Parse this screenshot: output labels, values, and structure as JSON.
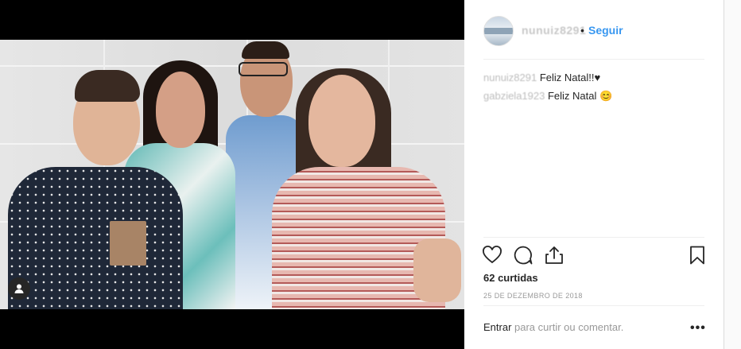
{
  "header": {
    "username": "nunuiz8291",
    "separator": "•",
    "follow_label": "Seguir"
  },
  "comments": [
    {
      "user": "nunuiz8291",
      "text": "Feliz Natal!!♥"
    },
    {
      "user": "gabziela1923",
      "text": "Feliz Natal 😊"
    }
  ],
  "actions": {
    "like_icon": "heart-icon",
    "comment_icon": "comment-icon",
    "share_icon": "share-icon",
    "save_icon": "bookmark-icon"
  },
  "likes_text": "62 curtidas",
  "date_text": "25 DE DEZEMBRO DE 2018",
  "login": {
    "link": "Entrar",
    "rest": " para curtir ou comentar."
  },
  "more_label": "•••",
  "colors": {
    "link_blue": "#3897f0",
    "text": "#262626",
    "muted": "#999999"
  }
}
